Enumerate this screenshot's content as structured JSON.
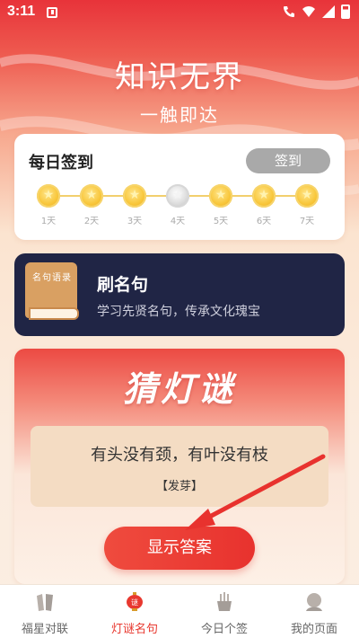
{
  "status_bar": {
    "time": "3:11"
  },
  "hero": {
    "title": "知识无界",
    "subtitle": "一触即达"
  },
  "signin": {
    "title": "每日签到",
    "button_label": "签到",
    "days": [
      {
        "label": "1天",
        "state": "gold"
      },
      {
        "label": "2天",
        "state": "gold"
      },
      {
        "label": "3天",
        "state": "gold"
      },
      {
        "label": "4天",
        "state": "silver"
      },
      {
        "label": "5天",
        "state": "gold"
      },
      {
        "label": "6天",
        "state": "gold"
      },
      {
        "label": "7天",
        "state": "gold"
      }
    ]
  },
  "quote_card": {
    "book_label": "名句语录",
    "title": "刷名句",
    "description": "学习先贤名句，传承文化瑰宝"
  },
  "riddle_card": {
    "logo": "猜灯谜",
    "question": "有头没有颈，有叶没有枝",
    "hint": "【发芽】",
    "answer_button": "显示答案"
  },
  "bottom_nav": {
    "items": [
      {
        "label": "福星对联",
        "icon": "couplet-icon",
        "active": false
      },
      {
        "label": "灯谜名句",
        "icon": "lantern-riddle-icon",
        "active": true
      },
      {
        "label": "今日个签",
        "icon": "fortune-sticks-icon",
        "active": false
      },
      {
        "label": "我的页面",
        "icon": "profile-icon",
        "active": false
      }
    ]
  },
  "colors": {
    "accent": "#e8382f",
    "card_dark": "#202545",
    "coin_gold": "#f8c63a"
  }
}
